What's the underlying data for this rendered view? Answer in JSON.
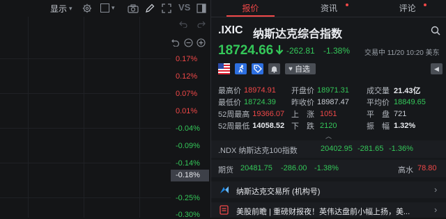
{
  "toolbar": {
    "display_label": "显示",
    "vs_label": "VS"
  },
  "axis": {
    "labels": [
      "0.17%",
      "0.12%",
      "0.07%",
      "0.01%",
      "-0.04%",
      "-0.09%",
      "-0.14%",
      "-0.18%",
      "-0.25%",
      "-0.30%"
    ],
    "current_label": "-0.18%"
  },
  "tabs": [
    {
      "label": "报价",
      "active": true
    },
    {
      "label": "资讯",
      "active": false
    },
    {
      "label": "评论",
      "active": false
    }
  ],
  "quote": {
    "symbol": ".IXIC",
    "name": "纳斯达克综合指数",
    "price": "18724.66",
    "change": "-262.81",
    "change_pct": "-1.38%",
    "trade_time": "交易中 11/20 10:20 美东",
    "watch_label": "自选"
  },
  "stats": {
    "high_label": "最高价",
    "high": "18974.91",
    "open_label": "开盘价",
    "open": "18971.31",
    "volume_label": "成交量",
    "volume": "21.43亿",
    "low_label": "最低价",
    "low": "18724.39",
    "prev_close_label": "昨收价",
    "prev_close": "18987.47",
    "avg_label": "平均价",
    "avg": "18849.65",
    "wk52_high_label": "52周最高",
    "wk52_high": "19366.07",
    "up_label": "上　涨",
    "up": "1051",
    "flat_label": "平　盘",
    "flat": "721",
    "wk52_low_label": "52周最低",
    "wk52_low": "14058.52",
    "down_label": "下　跌",
    "down": "2120",
    "amp_label": "振　幅",
    "amp": "1.32%"
  },
  "related": {
    "ndx_label": ".NDX 纳斯达克100指数",
    "ndx_price": "20402.95",
    "ndx_change": "-281.65",
    "ndx_pct": "-1.36%",
    "futures_label": "期货",
    "futures_price": "20481.75",
    "futures_change": "-286.00",
    "futures_pct": "-1.38%",
    "gauge_label": "高水",
    "gauge_value": "78.80"
  },
  "exchange": {
    "label": "纳斯达克交易所 (机构号)"
  },
  "news": {
    "headline": "美股前瞻 | 重磅财报夜！英伟达盘前小幅上扬，美..."
  },
  "colors": {
    "up": "#f04848",
    "down": "#34c759",
    "accent": "#f04848",
    "background": "#141517"
  }
}
